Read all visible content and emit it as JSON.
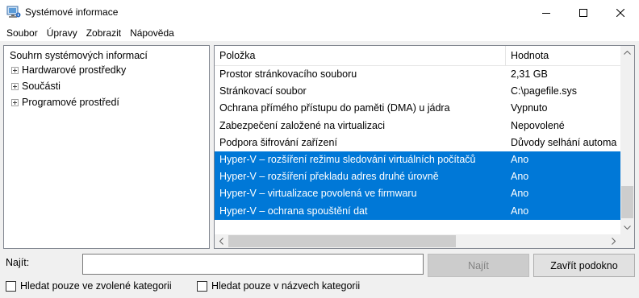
{
  "window": {
    "title": "Systémové informace",
    "icon": "system-info-icon"
  },
  "menu": [
    "Soubor",
    "Úpravy",
    "Zobrazit",
    "Nápověda"
  ],
  "tree": {
    "root": "Souhrn systémových informací",
    "children": [
      "Hardwarové prostředky",
      "Součásti",
      "Programové prostředí"
    ]
  },
  "list": {
    "columns": [
      "Položka",
      "Hodnota"
    ],
    "rows": [
      {
        "item": "Prostor stránkovacího souboru",
        "value": "2,31 GB",
        "selected": false
      },
      {
        "item": "Stránkovací soubor",
        "value": "C:\\pagefile.sys",
        "selected": false
      },
      {
        "item": "Ochrana přímého přístupu do paměti (DMA) u jádra",
        "value": "Vypnuto",
        "selected": false
      },
      {
        "item": "Zabezpečení založené na virtualizaci",
        "value": "Nepovolené",
        "selected": false
      },
      {
        "item": "Podpora šifrování zařízení",
        "value": "Důvody selhání automa",
        "selected": false
      },
      {
        "item": "Hyper-V – rozšíření režimu sledování virtuálních počítačů",
        "value": "Ano",
        "selected": true
      },
      {
        "item": "Hyper-V – rozšíření překladu adres druhé úrovně",
        "value": "Ano",
        "selected": true
      },
      {
        "item": "Hyper-V – virtualizace povolená ve firmwaru",
        "value": "Ano",
        "selected": true
      },
      {
        "item": "Hyper-V – ochrana spouštění dat",
        "value": "Ano",
        "selected": true
      }
    ]
  },
  "find": {
    "label": "Najít:",
    "value": "",
    "find_button": "Najít",
    "close_button": "Zavřít podokno",
    "option_selected_category": "Hledat pouze ve zvolené kategorii",
    "option_category_names": "Hledat pouze v názvech kategorii"
  },
  "colors": {
    "selection": "#0078d7",
    "window_bg": "#f0f0f0"
  }
}
